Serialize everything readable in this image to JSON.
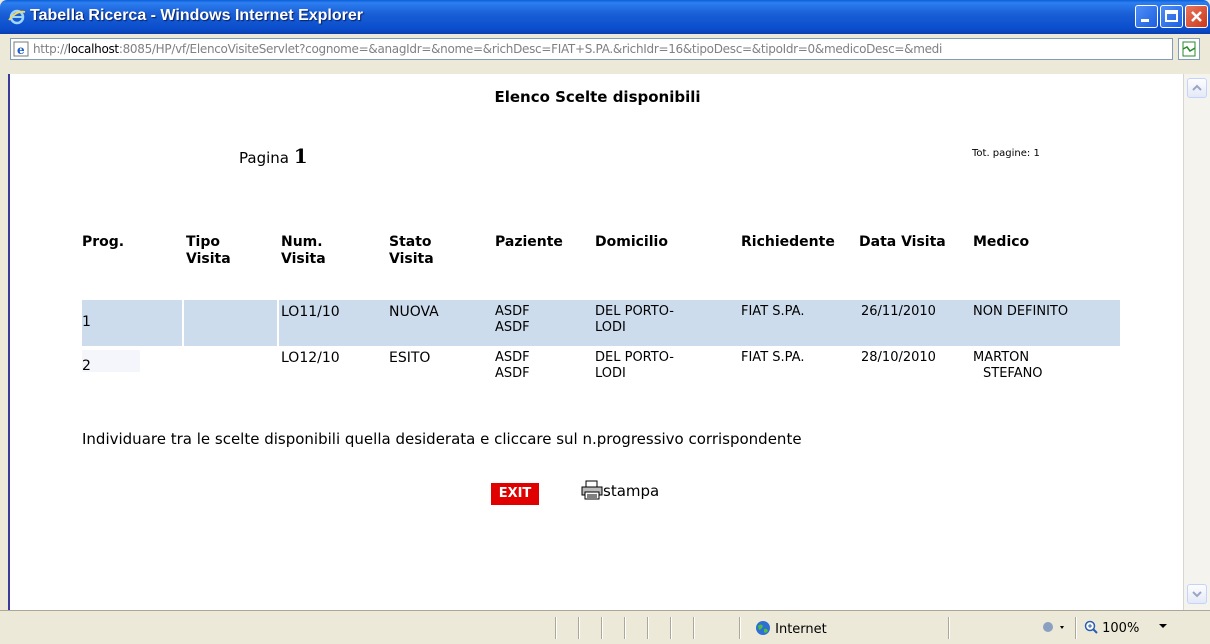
{
  "window": {
    "title": "Tabella Ricerca - Windows Internet Explorer",
    "controls": [
      "minimize",
      "maximize",
      "close"
    ]
  },
  "address_bar": {
    "url_prefix": "http://",
    "url_host": "localhost",
    "url_rest": ":8085/HP/vf/ElencoVisiteServlet?cognome=&anagIdr=&nome=&richDesc=FIAT+S.PA.&richIdr=16&tipoDesc=&tipoIdr=0&medicoDesc=&medi"
  },
  "page": {
    "title": "Elenco Scelte disponibili",
    "pagina_label": "Pagina",
    "pagina_number": "1",
    "tot_pagine": "Tot. pagine: 1",
    "instructions": "Individuare tra le scelte disponibili quella desiderata e cliccare sul n.progressivo corrispondente",
    "exit_label": "EXIT",
    "stampa_label": "stampa"
  },
  "table": {
    "headers": {
      "prog": "Prog.",
      "tipo_1": "Tipo",
      "tipo_2": "Visita",
      "num_1": "Num.",
      "num_2": "Visita",
      "stato_1": "Stato",
      "stato_2": "Visita",
      "paziente": "Paziente",
      "domicilio": "Domicilio",
      "richiedente": "Richiedente",
      "data_visita": "Data Visita",
      "medico": "Medico"
    },
    "rows": [
      {
        "prog": "1",
        "tipo": "",
        "num": "LO11/10",
        "stato": "NUOVA",
        "paziente_1": "ASDF",
        "paziente_2": "ASDF",
        "domicilio_1": "DEL PORTO-",
        "domicilio_2": "LODI",
        "richiedente": "FIAT S.PA.",
        "data": "26/11/2010",
        "medico_1": "NON DEFINITO",
        "medico_2": ""
      },
      {
        "prog": "2",
        "tipo": "",
        "num": "LO12/10",
        "stato": "ESITO",
        "paziente_1": "ASDF",
        "paziente_2": "ASDF",
        "domicilio_1": "DEL PORTO-",
        "domicilio_2": "LODI",
        "richiedente": "FIAT S.PA.",
        "data": "28/10/2010",
        "medico_1": "MARTON",
        "medico_2": "STEFANO"
      }
    ]
  },
  "status_bar": {
    "zone": "Internet",
    "zoom": "100%"
  },
  "colors": {
    "row_highlight": "#cddced",
    "exit_button": "#e00000",
    "titlebar": "#0b4dcc"
  }
}
